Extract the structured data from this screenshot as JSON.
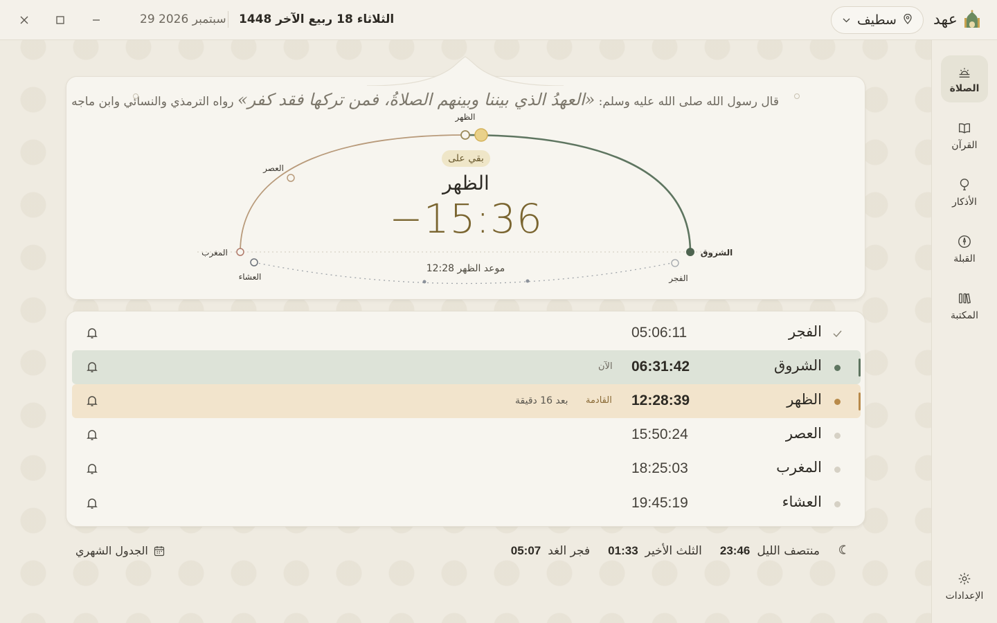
{
  "app": {
    "name": "عهد"
  },
  "header": {
    "city": "سطيف",
    "hijri_date": "الثلاثاء 18 ربيع الآخر 1448",
    "gregorian_date": "29 سبتمبر 2026"
  },
  "sidebar": {
    "items": [
      {
        "label": "الصلاة",
        "icon": "sunrise-icon",
        "active": true
      },
      {
        "label": "القرآن",
        "icon": "book-icon",
        "active": false
      },
      {
        "label": "الأذكار",
        "icon": "prayer-beads-icon",
        "active": false
      },
      {
        "label": "القبلة",
        "icon": "compass-icon",
        "active": false
      },
      {
        "label": "المكتبة",
        "icon": "library-icon",
        "active": false
      }
    ],
    "settings_label": "الإعدادات"
  },
  "hero": {
    "hadith_prefix": "قال رسول الله صلى الله عليه وسلم:",
    "hadith_text": "«العهدُ الذي بيننا وبينهم الصلاةُ، فمن تركها فقد كفر»",
    "hadith_source": "رواه الترمذي والنسائي وابن ماجه",
    "remaining_label": "بقي على",
    "next_prayer": "الظهر",
    "countdown": "−15:36",
    "appointment": "موعد الظهر 12:28",
    "arc_labels": {
      "fajr": "الفجر",
      "sunrise": "الشروق",
      "dhuhr": "الظهر",
      "asr": "العصر",
      "maghrib": "المغرب",
      "isha": "العشاء"
    }
  },
  "prayers": [
    {
      "name": "الفجر",
      "time": "05:06:11",
      "state": "passed",
      "tag": "",
      "eta": ""
    },
    {
      "name": "الشروق",
      "time": "06:31:42",
      "state": "current",
      "tag": "الآن",
      "eta": ""
    },
    {
      "name": "الظهر",
      "time": "12:28:39",
      "state": "upcoming",
      "tag": "القادمة",
      "eta": "بعد 16 دقيقة"
    },
    {
      "name": "العصر",
      "time": "15:50:24",
      "state": "future",
      "tag": "",
      "eta": ""
    },
    {
      "name": "المغرب",
      "time": "18:25:03",
      "state": "future",
      "tag": "",
      "eta": ""
    },
    {
      "name": "العشاء",
      "time": "19:45:19",
      "state": "future",
      "tag": "",
      "eta": ""
    }
  ],
  "footer": {
    "midnight_label": "منتصف الليل",
    "midnight_time": "23:46",
    "last_third_label": "الثلث الأخير",
    "last_third_time": "01:33",
    "next_fajr_label": "فجر الغد",
    "next_fajr_time": "05:07",
    "monthly_label": "الجدول الشهري"
  },
  "colors": {
    "accent_green": "#5e7560",
    "accent_gold": "#b89a55",
    "current_row": "#dde3d8",
    "upcoming_row": "#f2e4cc"
  }
}
